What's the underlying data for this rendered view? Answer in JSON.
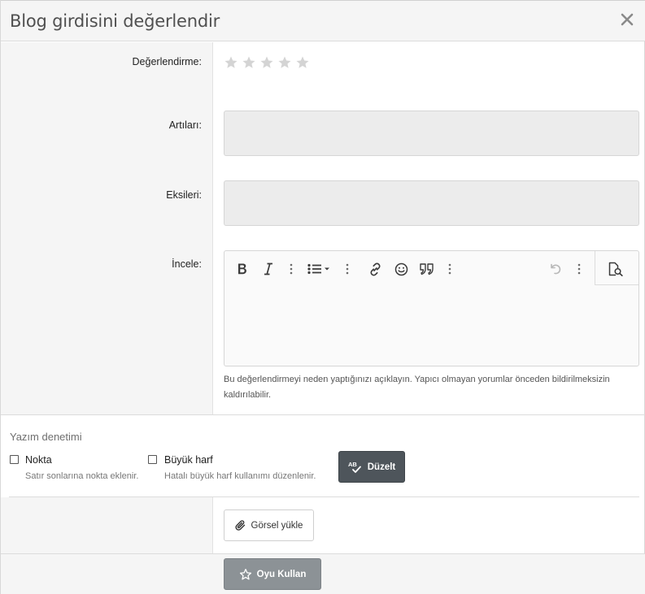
{
  "dialog": {
    "title": "Blog girdisini değerlendir",
    "close_icon": "close-icon"
  },
  "form": {
    "rating_label": "Değerlendirme:",
    "rating": {
      "value": 0,
      "max": 5,
      "star_color": "#d4d4d4"
    },
    "pros_label": "Artıları:",
    "pros_value": "",
    "cons_label": "Eksileri:",
    "cons_value": "",
    "review_label": "İncele:",
    "review_value": "",
    "review_hint": "Bu değerlendirmeyi neden yaptığınızı açıklayın. Yapıcı olmayan yorumlar önceden bildirilmeksizin kaldırılabilir."
  },
  "editor_toolbar": {
    "items": [
      "bold-icon",
      "italic-icon",
      "more-vertical-icon",
      "list-icon",
      "more-vertical-icon",
      "link-icon",
      "smile-icon",
      "quote-icon",
      "more-vertical-icon",
      "undo-icon",
      "more-vertical-icon",
      "preview-icon"
    ]
  },
  "spellcheck": {
    "title": "Yazım denetimi",
    "option_1_label": "Nokta",
    "option_1_desc": "Satır sonlarına nokta eklenir.",
    "option_1_checked": false,
    "option_2_label": "Büyük harf",
    "option_2_desc": "Hatalı büyük harf kullanımı düzenlenir.",
    "option_2_checked": false,
    "fix_button": "Düzelt"
  },
  "upload_button": "Görsel yükle",
  "submit_button": "Oyu Kullan",
  "colors": {
    "fix_button_bg": "#4e555b",
    "submit_button_bg": "#8c9296",
    "panel_bg": "#f5f5f5"
  }
}
